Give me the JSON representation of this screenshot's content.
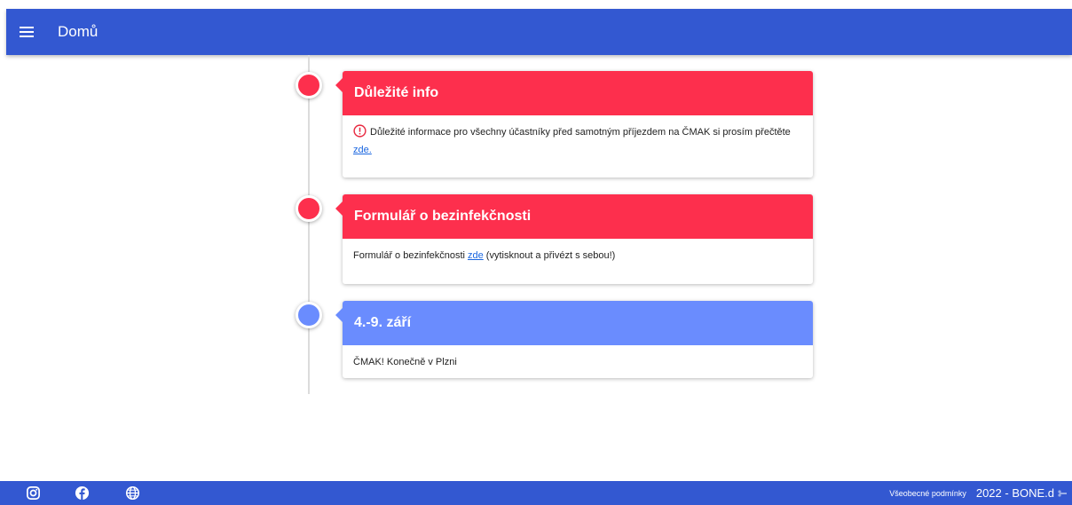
{
  "appbar": {
    "title": "Domů"
  },
  "timeline": [
    {
      "title": "Důležité info",
      "color": "#fd2f4d",
      "body_text": "Důležité informace pro všechny účastníky před samotným příjezdem na ČMAK si prosím přečtěte ",
      "link_text": "zde.",
      "body_suffix": "",
      "icon": "alert-circle-icon"
    },
    {
      "title": "Formulář o bezinfekčnosti",
      "color": "#fd2f4d",
      "body_text": "Formulář o bezinfekčnosti ",
      "link_text": "zde",
      "body_suffix": " (vytisknout a přivézt s sebou!)"
    },
    {
      "title": "4.-9. září",
      "color": "#6a8cfe",
      "body_text": "ČMAK! Konečně v Plzni"
    }
  ],
  "footer": {
    "icons": [
      "instagram-icon",
      "facebook-icon",
      "globe-icon"
    ],
    "terms_label": "Všeobecné podmínky",
    "copyright": "2022 - BONE.d"
  },
  "colors": {
    "primary": "#3358d1",
    "alert": "#fd2f4d",
    "event": "#6a8cfe"
  }
}
